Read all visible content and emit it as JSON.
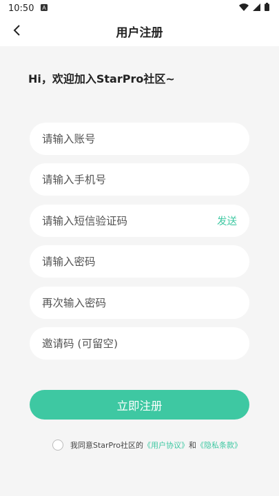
{
  "status_bar": {
    "time": "10:50",
    "notification_icon": "a-icon",
    "icons": [
      "wifi-icon",
      "signal-icon",
      "battery-icon"
    ]
  },
  "app_bar": {
    "back_icon": "chevron-left-icon",
    "title": "用户注册"
  },
  "greeting": "Hi，欢迎加入StarPro社区~",
  "form": {
    "account_placeholder": "请输入账号",
    "phone_placeholder": "请输入手机号",
    "sms_code_placeholder": "请输入短信验证码",
    "send_label": "发送",
    "password_placeholder": "请输入密码",
    "confirm_password_placeholder": "再次输入密码",
    "invite_code_placeholder": "邀请码 (可留空)",
    "submit_label": "立即注册"
  },
  "agreement": {
    "prefix": "我同意StarPro社区的",
    "user_agreement": "《用户协议》",
    "and": "和",
    "privacy_policy": "《隐私条款》"
  },
  "colors": {
    "accent": "#3ec8a2",
    "background": "#f5f5f5",
    "surface": "#ffffff"
  }
}
